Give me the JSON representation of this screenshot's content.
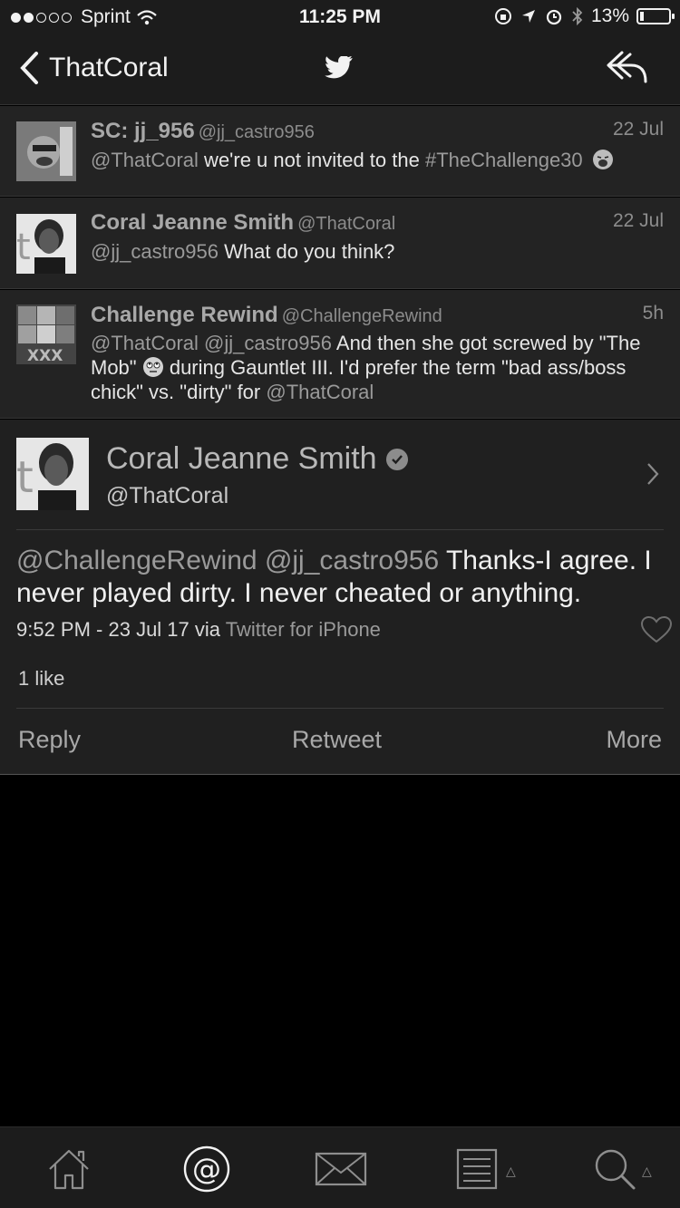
{
  "status_bar": {
    "carrier": "Sprint",
    "time": "11:25 PM",
    "battery": "13%",
    "battery_level": 0.13,
    "signal_bars_filled": 2,
    "signal_bars_total": 5
  },
  "nav": {
    "back_label": "ThatCoral",
    "icons": [
      "back-chevron-icon",
      "twitter-bird-icon",
      "reply-icon"
    ]
  },
  "tweets": [
    {
      "name": "SC: jj_956",
      "handle": "@jj_castro956",
      "time": "22 Jul",
      "mention": "@ThatCoral",
      "text": " we're u not invited to the ",
      "hashtag": "#TheChallenge30"
    },
    {
      "name": "Coral Jeanne Smith",
      "handle": "@ThatCoral",
      "time": "22 Jul",
      "mention": "@jj_castro956",
      "text": " What do you think?"
    },
    {
      "name": "Challenge Rewind",
      "handle": "@ChallengeRewind",
      "time": "5h",
      "mention": "@ThatCoral @jj_castro956",
      "text_part1": " And then she got screwed by \"The Mob\" ",
      "text_part2": " during Gauntlet III. I'd prefer the term \"bad ass/boss chick\" vs. \"dirty\" for ",
      "mention_end": "@ThatCoral"
    }
  ],
  "detail": {
    "name": "Coral Jeanne Smith",
    "handle": "@ThatCoral",
    "mentions": "@ChallengeRewind @jj_castro956",
    "text": " Thanks-I agree. I never played dirty. I never cheated or anything.",
    "timestamp": "9:52 PM - 23 Jul 17 via ",
    "via": "Twitter for iPhone",
    "likes": "1 like",
    "actions": {
      "reply": "Reply",
      "retweet": "Retweet",
      "more": "More"
    }
  },
  "tabbar": {
    "tabs": [
      "home-icon",
      "mentions-icon",
      "messages-icon",
      "lists-icon",
      "search-icon"
    ]
  }
}
